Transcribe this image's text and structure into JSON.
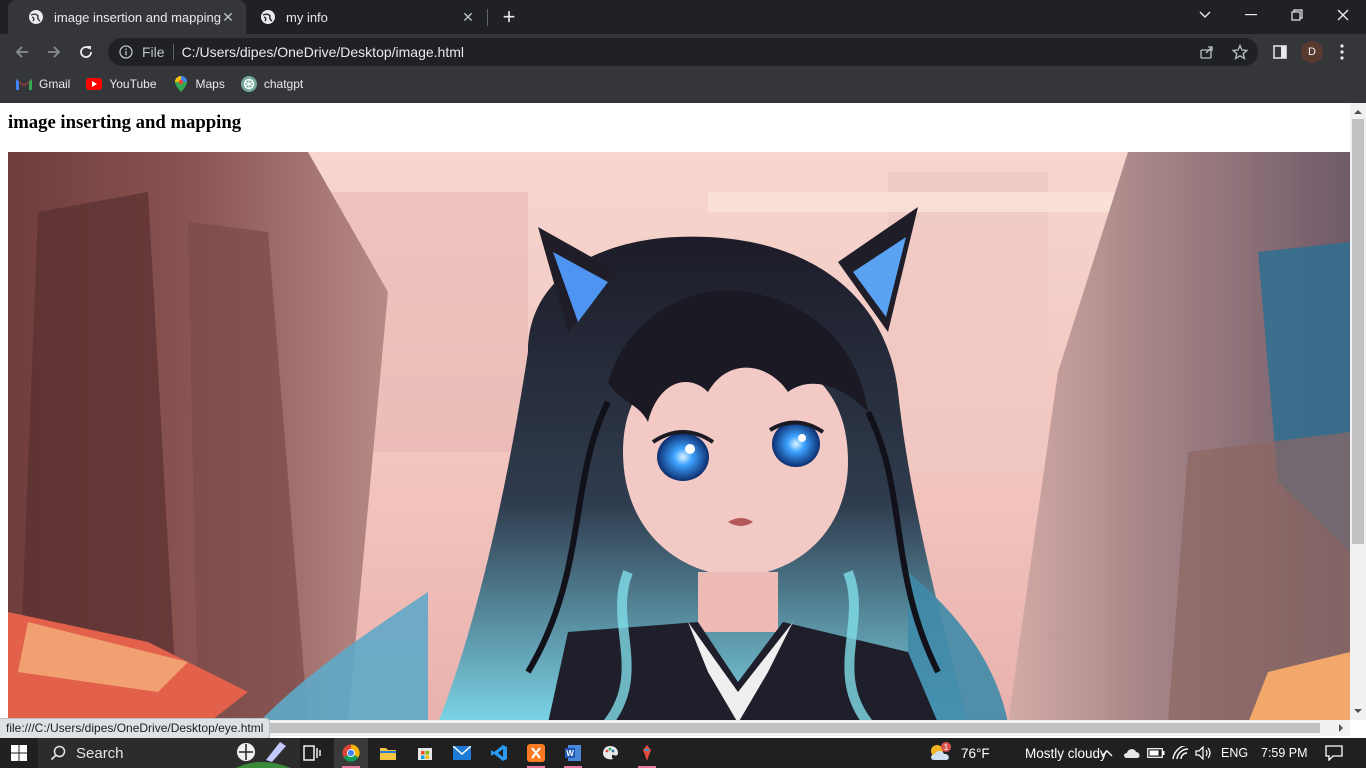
{
  "tabs": [
    {
      "title": "image insertion and mapping",
      "active": true
    },
    {
      "title": "my info",
      "active": false
    }
  ],
  "toolbar": {
    "file_label": "File",
    "url": "C:/Users/dipes/OneDrive/Desktop/image.html",
    "profile_initial": "D"
  },
  "bookmarks": [
    {
      "label": "Gmail",
      "icon": "gmail-icon"
    },
    {
      "label": "YouTube",
      "icon": "youtube-icon"
    },
    {
      "label": "Maps",
      "icon": "maps-icon"
    },
    {
      "label": "chatgpt",
      "icon": "chatgpt-icon"
    }
  ],
  "page": {
    "heading": "image inserting and mapping"
  },
  "status_url": "file:///C:/Users/dipes/OneDrive/Desktop/eye.html",
  "taskbar": {
    "search_label": "Search",
    "weather_temp": "76°F",
    "weather_desc": "Mostly cloudy",
    "weather_badge": "1",
    "language": "ENG",
    "time": "7:59 PM"
  },
  "colors": {
    "chrome_dark": "#202124",
    "chrome_toolbar": "#35363a",
    "taskbar": "#202020",
    "accent_pink": "#e67a9e"
  }
}
